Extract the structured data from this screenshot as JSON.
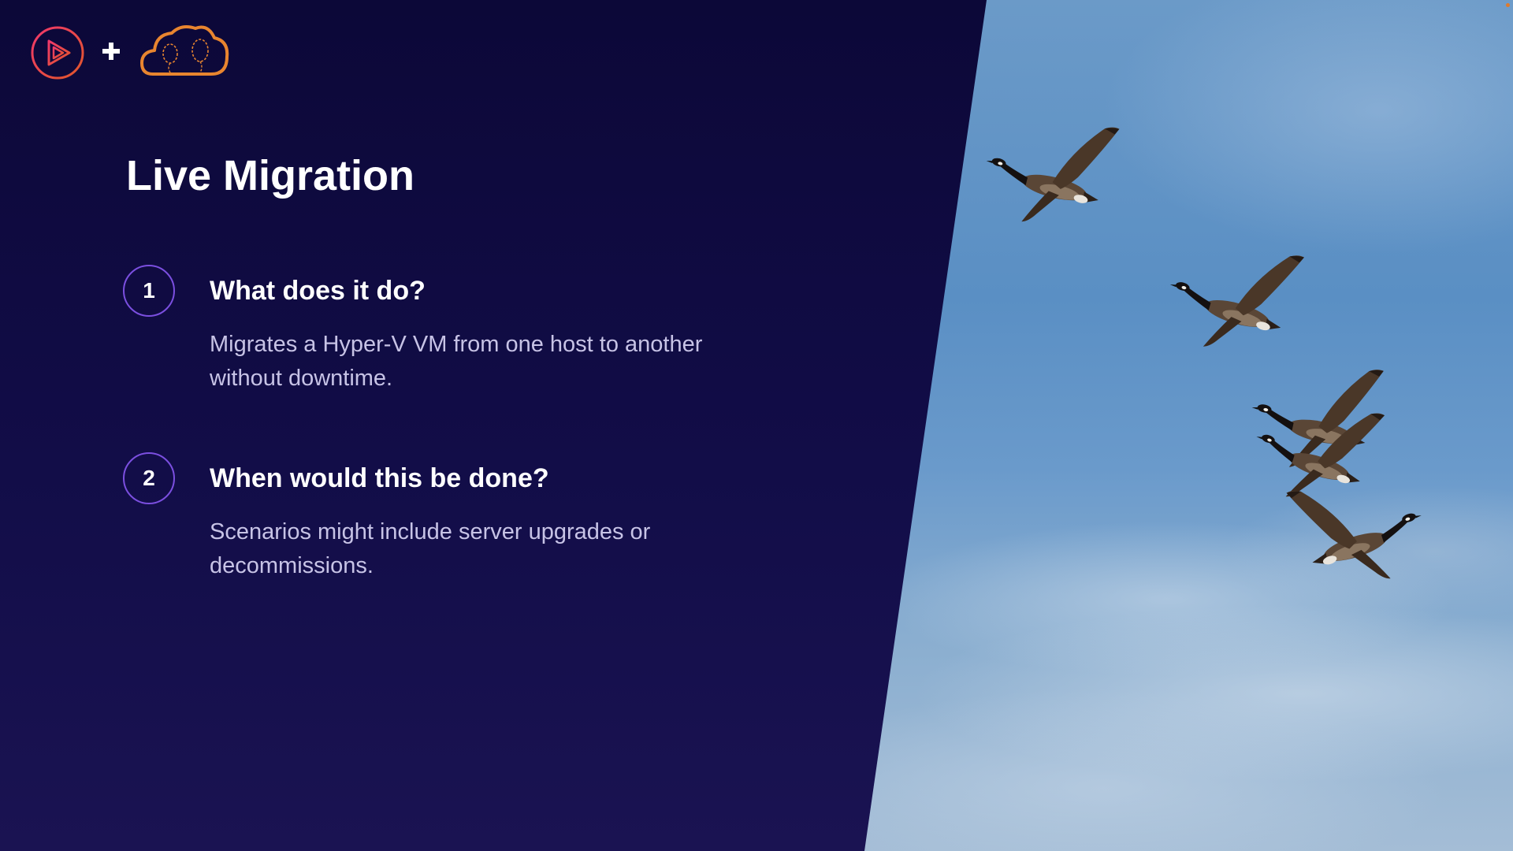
{
  "slide": {
    "title": "Live Migration",
    "items": [
      {
        "number": "1",
        "heading": "What does it do?",
        "text": "Migrates a Hyper-V VM from one host to another without downtime."
      },
      {
        "number": "2",
        "heading": "When would this be done?",
        "text": "Scenarios might include server upgrades or decommissions."
      }
    ]
  },
  "logos": {
    "left": "play-icon",
    "joiner": "plus-icon",
    "right": "cloud-balloons-icon"
  },
  "colors": {
    "background": "#0f0b3a",
    "accent_purple": "#7b4fe0",
    "play_logo": "#e0304f",
    "cloud_logo": "#e8852f",
    "body_text": "#c7c3e6"
  },
  "photo": {
    "subject": "geese-flying-sky"
  }
}
